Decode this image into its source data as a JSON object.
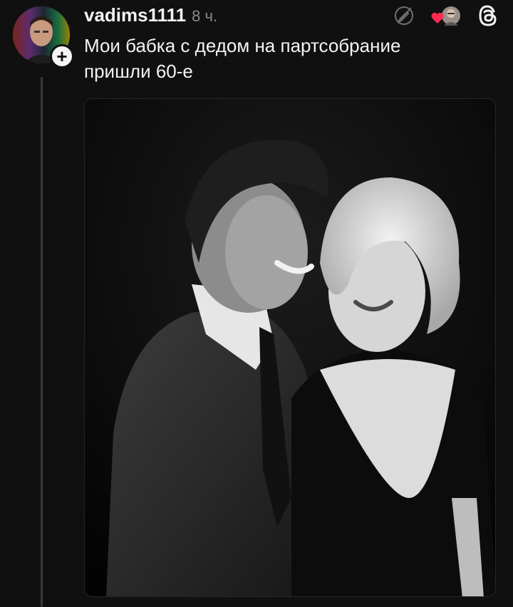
{
  "post": {
    "username": "vadims1111",
    "time": "8 ч.",
    "text": "Мои бабка с дедом на партсобрание\nпришли 60-е"
  },
  "icons": {
    "follow": "plus-icon",
    "edit": "edit-off-icon",
    "liked_by": "heart-avatar-icon",
    "app": "threads-logo-icon"
  },
  "colors": {
    "background": "#101010",
    "text": "#f3f3f3",
    "muted": "#8a8a8a",
    "heart": "#ff2a4f"
  }
}
